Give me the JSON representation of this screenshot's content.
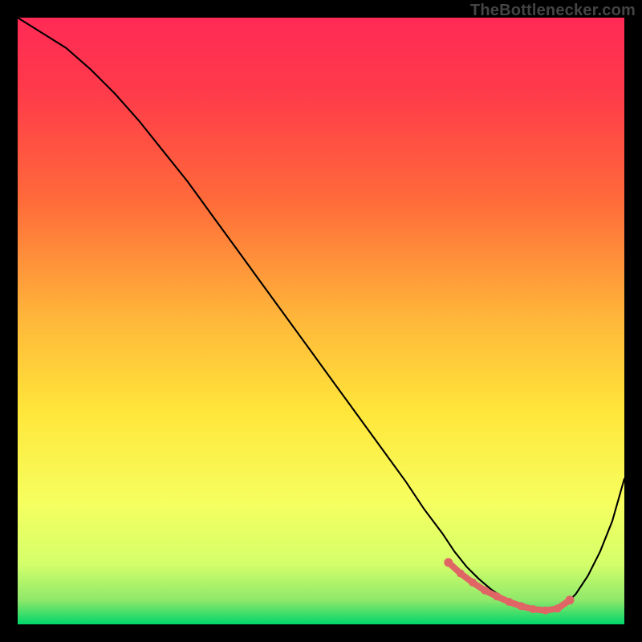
{
  "attribution": "TheBottlenecker.com",
  "colors": {
    "gradient_top": "#ff2a4d",
    "gradient_mid_upper": "#ff6a3a",
    "gradient_mid": "#ffd23a",
    "gradient_mid_lower": "#f6ff60",
    "gradient_lower": "#d4ff6a",
    "gradient_bottom": "#00d66a",
    "curve": "#000000",
    "marker": "#e06666",
    "frame": "#000000"
  },
  "chart_data": {
    "type": "line",
    "title": "",
    "xlabel": "",
    "ylabel": "",
    "xlim": [
      0,
      100
    ],
    "ylim": [
      0,
      100
    ],
    "grid": false,
    "legend": null,
    "series": [
      {
        "name": "bottleneck-curve",
        "x": [
          0,
          4,
          8,
          12,
          16,
          20,
          24,
          28,
          32,
          36,
          40,
          44,
          48,
          52,
          56,
          60,
          64,
          67,
          70,
          72,
          74,
          76,
          78,
          80,
          82,
          84,
          86,
          88,
          90,
          92,
          94,
          96,
          98,
          100
        ],
        "y": [
          100,
          97.5,
          95,
          91.5,
          87.5,
          83,
          78,
          73,
          67.5,
          62,
          56.5,
          51,
          45.5,
          40,
          34.5,
          29,
          23.5,
          19,
          15,
          12,
          9.5,
          7.5,
          5.8,
          4.4,
          3.3,
          2.6,
          2.2,
          2.2,
          3.0,
          5.0,
          8.0,
          12.0,
          17.0,
          24.0
        ]
      }
    ],
    "optimal_region": {
      "name": "optimal-band",
      "x": [
        71,
        73,
        75,
        77,
        79,
        81,
        83,
        85,
        87,
        89,
        91
      ],
      "y": [
        10.2,
        8.4,
        6.9,
        5.6,
        4.6,
        3.7,
        3.0,
        2.5,
        2.3,
        2.6,
        4.0
      ]
    }
  }
}
